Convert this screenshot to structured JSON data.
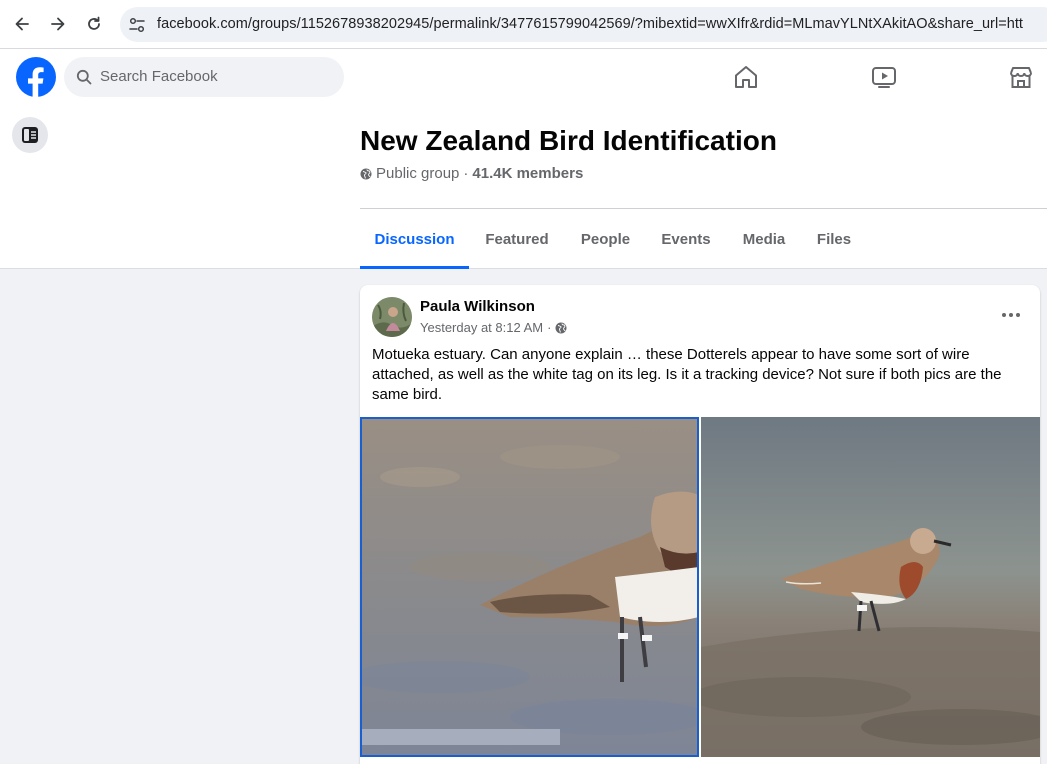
{
  "browser": {
    "url": "facebook.com/groups/1152678938202945/permalink/3477615799042569/?mibextid=wwXIfr&rdid=MLmavYLNtXAkitAO&share_url=htt"
  },
  "topbar": {
    "search_placeholder": "Search Facebook",
    "icons": [
      "home-icon",
      "video-icon",
      "marketplace-icon"
    ]
  },
  "group": {
    "title": "New Zealand Bird Identification",
    "privacy": "Public group",
    "separator": "·",
    "members": "41.4K members"
  },
  "tabs": [
    {
      "label": "Discussion",
      "active": true
    },
    {
      "label": "Featured",
      "active": false
    },
    {
      "label": "People",
      "active": false
    },
    {
      "label": "Events",
      "active": false
    },
    {
      "label": "Media",
      "active": false
    },
    {
      "label": "Files",
      "active": false
    }
  ],
  "post": {
    "author": "Paula Wilkinson",
    "time": "Yesterday at 8:12 AM",
    "separator": "·",
    "text": "Motueka estuary. Can anyone explain … these Dotterels appear to have some sort of wire attached, as well as the white tag on its leg. Is it a tracking device? Not sure if both pics are the same bird."
  },
  "colors": {
    "brand": "#0866ff",
    "background": "#f0f2f5",
    "secondary_text": "#65676b"
  }
}
